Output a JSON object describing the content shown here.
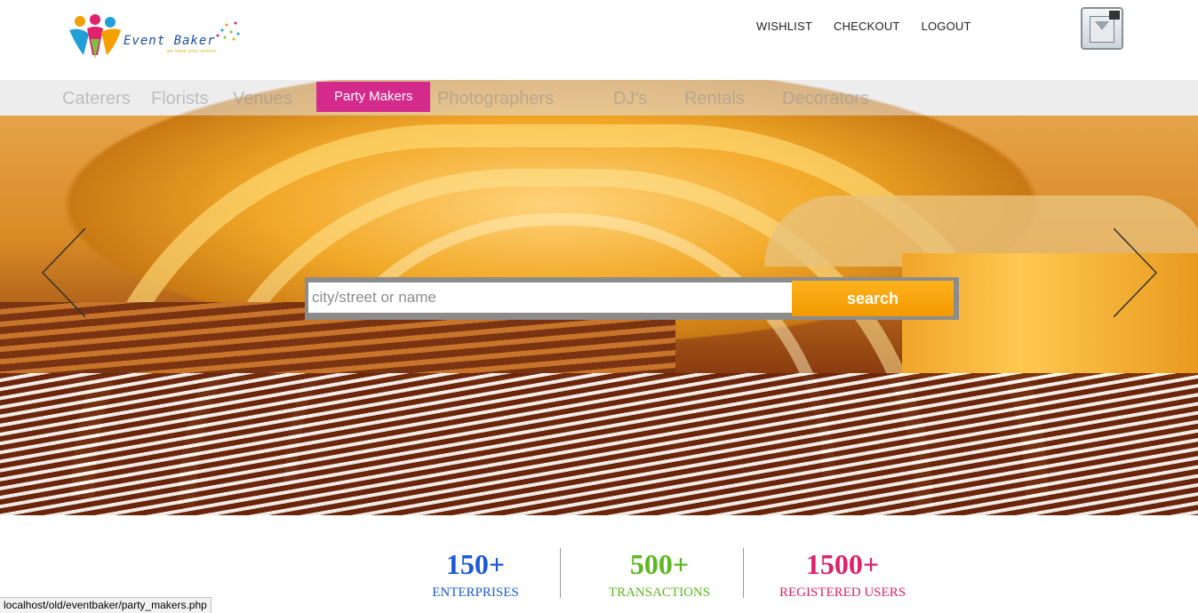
{
  "header": {
    "logo_text": "Event Baker",
    "logo_tagline": "we bake your events",
    "nav": [
      "WISHLIST",
      "CHECKOUT",
      "LOGOUT"
    ]
  },
  "categories": {
    "items": [
      "Caterers",
      "Florists",
      "Venues",
      "Party Makers",
      "Photographers",
      "DJ's",
      "Rentals",
      "Decorators"
    ],
    "active": "Party Makers"
  },
  "search": {
    "placeholder": "city/street or name",
    "button_label": "search"
  },
  "stats": [
    {
      "value": "150+",
      "label": "ENTERPRISES",
      "color": "#1a5bd6"
    },
    {
      "value": "500+",
      "label": "TRANSACTIONS",
      "color": "#5cb81f"
    },
    {
      "value": "1500+",
      "label": "REGISTERED USERS",
      "color": "#e0226b"
    }
  ],
  "status_bar": {
    "url": "localhost/old/eventbaker/party_makers.php"
  },
  "colors": {
    "accent_pink": "#d42a8c",
    "search_orange": "#f7a30b"
  }
}
